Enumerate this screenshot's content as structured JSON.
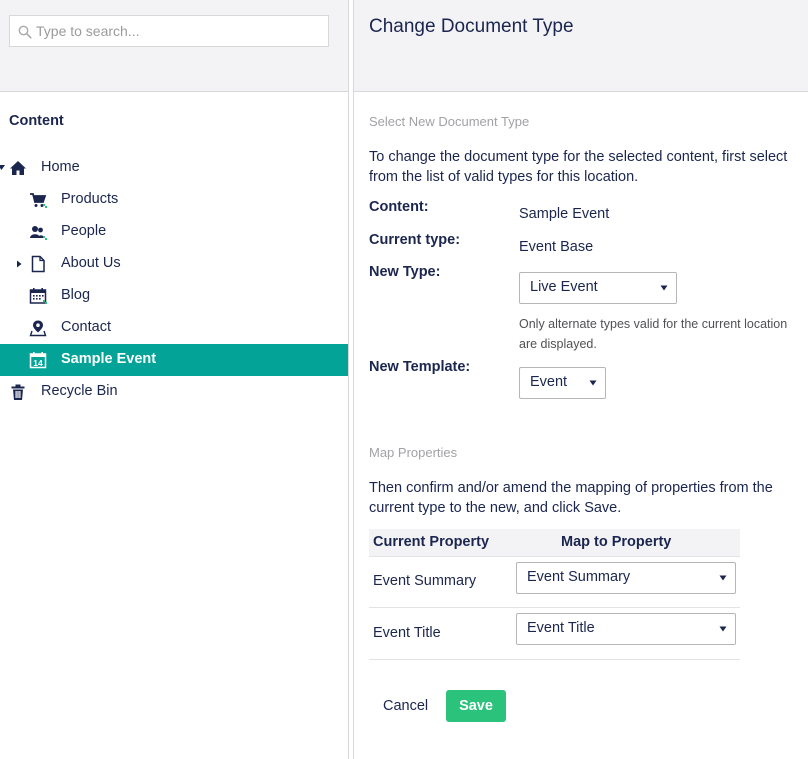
{
  "search": {
    "placeholder": "Type to search..."
  },
  "tree": {
    "title": "Content",
    "items": [
      {
        "label": "Home",
        "icon": "home-icon"
      },
      {
        "label": "Products",
        "icon": "shopping-cart-icon"
      },
      {
        "label": "People",
        "icon": "users-icon"
      },
      {
        "label": "About Us",
        "icon": "document-icon"
      },
      {
        "label": "Blog",
        "icon": "calendar-grid-icon"
      },
      {
        "label": "Contact",
        "icon": "map-pin-icon"
      },
      {
        "label": "Sample Event",
        "icon": "calendar-14-icon",
        "badge": "14"
      },
      {
        "label": "Recycle Bin",
        "icon": "trash-icon"
      }
    ]
  },
  "dialog": {
    "title": "Change Document Type",
    "select_heading": "Select New Document Type",
    "intro": "To change the document type for the selected content, first select from the list of valid types for this location.",
    "content_label": "Content:",
    "content_value": "Sample Event",
    "current_type_label": "Current type:",
    "current_type_value": "Event Base",
    "new_type_label": "New Type:",
    "new_type_value": "Live Event",
    "new_type_help": "Only alternate types valid for the current location are displayed.",
    "new_template_label": "New Template:",
    "new_template_value": "Event",
    "map_heading": "Map Properties",
    "map_intro": "Then confirm and/or amend the mapping of properties from the current type to the new, and click Save.",
    "map_table": {
      "col_current": "Current Property",
      "col_map": "Map to Property",
      "rows": [
        {
          "current": "Event Summary",
          "mapped": "Event Summary"
        },
        {
          "current": "Event Title",
          "mapped": "Event Title"
        }
      ]
    },
    "cancel_label": "Cancel",
    "save_label": "Save"
  },
  "colors": {
    "selected_bg": "#03a497",
    "save_bg": "#2bc37c",
    "text": "#1b264f",
    "header_bg": "#f3f3f5"
  }
}
